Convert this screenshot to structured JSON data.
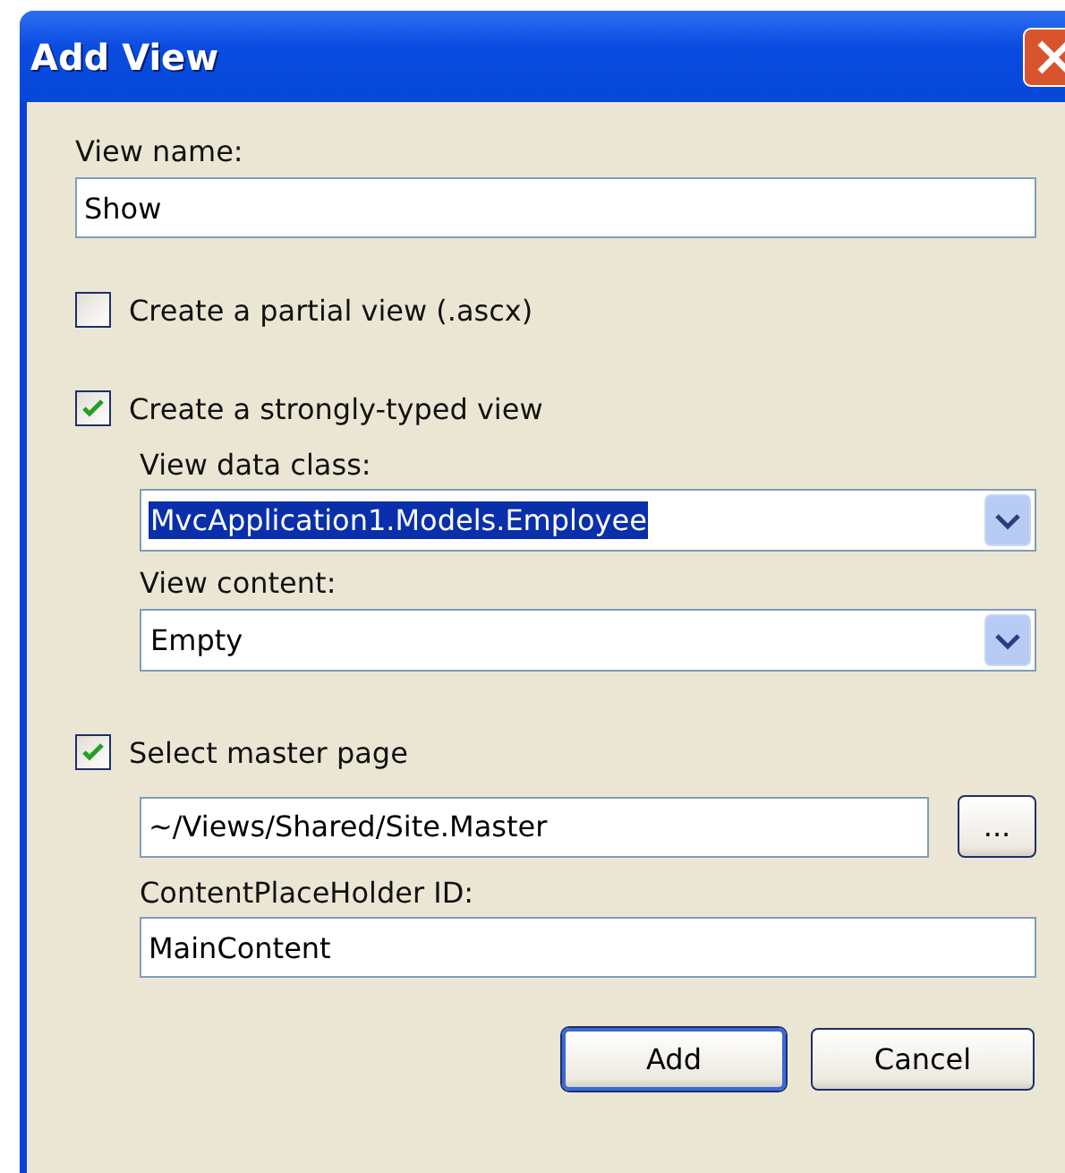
{
  "window": {
    "title": "Add View"
  },
  "view_name": {
    "label": "View name:",
    "value": "Show"
  },
  "partial_view": {
    "label": "Create a partial view (.ascx)",
    "checked": false
  },
  "strongly_typed": {
    "label": "Create a strongly-typed view",
    "checked": true
  },
  "view_data_class": {
    "label": "View data class:",
    "value": "MvcApplication1.Models.Employee",
    "highlighted": true
  },
  "view_content": {
    "label": "View content:",
    "value": "Empty",
    "highlighted": false
  },
  "master_page": {
    "label": "Select master page",
    "checked": true,
    "value": "~/Views/Shared/Site.Master",
    "browse_label": "..."
  },
  "content_placeholder": {
    "label": "ContentPlaceHolder ID:",
    "value": "MainContent"
  },
  "buttons": [
    {
      "label": "Add",
      "default": true
    },
    {
      "label": "Cancel",
      "default": false
    }
  ]
}
